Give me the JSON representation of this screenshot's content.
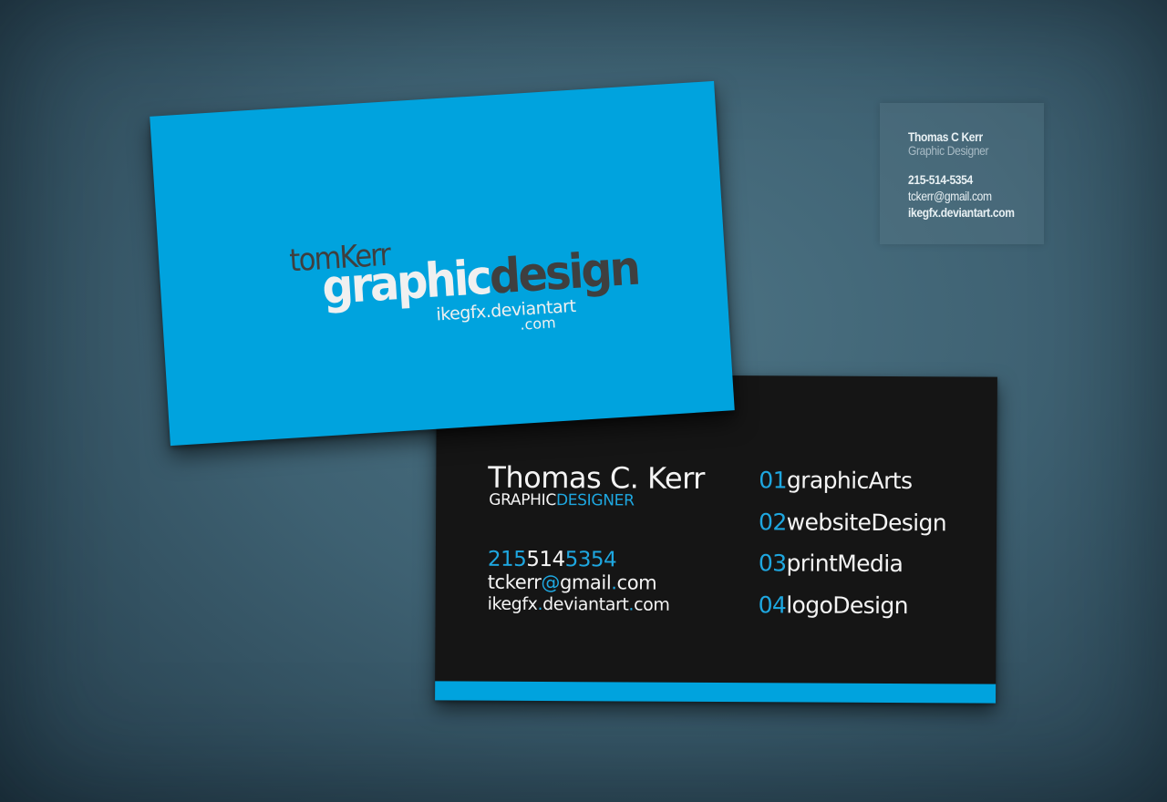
{
  "info_panel": {
    "name": "Thomas C Kerr",
    "title": "Graphic Designer",
    "phone": "215-514-5354",
    "email": "tckerr@gmail.com",
    "website": "ikegfx.deviantart.com"
  },
  "front_card": {
    "logo_first": "tom",
    "logo_last": "Kerr",
    "logo_word1": "graphic",
    "logo_word2": "design",
    "logo_url": "ikegfx.deviantart",
    "logo_tld": ".com"
  },
  "back_card": {
    "name": "Thomas C. Kerr",
    "role_part1": "GRAPHIC",
    "role_part2": "DESIGNER",
    "phone_parts": [
      "215",
      "514",
      "5354"
    ],
    "email_user": "tckerr",
    "email_at": "@",
    "email_domain": "gmail",
    "email_dot": ".",
    "email_tld": "com",
    "site_name": "ikegfx",
    "site_dot": ".",
    "site_rest": "deviantart",
    "site_dot2": ".",
    "site_tld": "com",
    "services": [
      {
        "number": "01",
        "label": "graphicArts"
      },
      {
        "number": "02",
        "label": "websiteDesign"
      },
      {
        "number": "03",
        "label": "printMedia"
      },
      {
        "number": "04",
        "label": "logoDesign"
      }
    ]
  },
  "colors": {
    "accent_blue": "#00a3de",
    "card_black": "#151515",
    "background": "#3e6172"
  }
}
